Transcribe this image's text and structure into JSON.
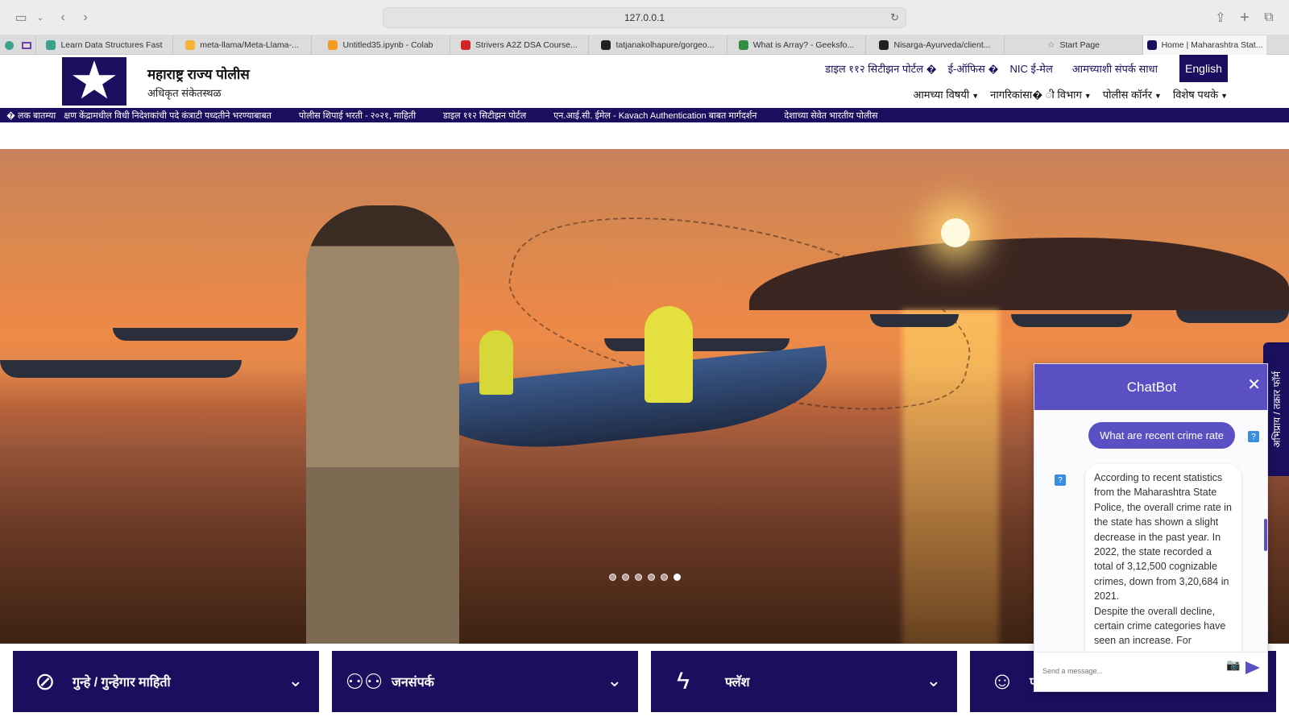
{
  "browser": {
    "url": "127.0.0.1",
    "tabs": [
      {
        "label": "Learn Data Structures Fast",
        "color": "#3ba38a"
      },
      {
        "label": "meta-llama/Meta-Llama-...",
        "color": "#f2b233"
      },
      {
        "label": "Untitled35.ipynb - Colab",
        "color": "#f49b21"
      },
      {
        "label": "Strivers A2Z DSA Course...",
        "color": "#d22525"
      },
      {
        "label": "tatjanakolhapure/gorgeo...",
        "color": "#222222"
      },
      {
        "label": "What is Array? - Geeksfo...",
        "color": "#2f8d46"
      },
      {
        "label": "Nisarga-Ayurveda/client...",
        "color": "#222222"
      },
      {
        "label": "Start Page",
        "color": "#999999"
      },
      {
        "label": "Home | Maharashtra Stat...",
        "color": "#1a0f5e"
      }
    ]
  },
  "header": {
    "title": "महाराष्ट्र राज्य पोलीस",
    "subtitle": "अधिकृत संकेतस्थळ",
    "top_links": [
      "डाइल ११२ सिटीझन पोर्टल �",
      "ई-ऑफिस �",
      "NIC ई-मेल",
      "आमच्याशी संपर्क साधा"
    ],
    "language_button": "English",
    "nav": [
      "आमच्या विषयी",
      "नागरिकांसा� ी विभाग",
      "पोलीस कॉर्नर",
      "विशेष पथके"
    ]
  },
  "ticker": {
    "lead": "� लक बातम्या",
    "items": [
      "क्षण केंद्रामधील विधी निदेशकांची पदे कंत्राटी पध्दतीने भरण्याबाबत",
      "पोलीस शिपाई भरती - २०२१, माहिती",
      "डाइल ११२ सिटीझन पोर्टल",
      "एन.आई.सी. ईमेल - Kavach Authentication बाबत मार्गदर्शन",
      "देशाच्या सेवेत भारतीय पोलीस"
    ]
  },
  "carousel": {
    "slides": 6,
    "active": 6
  },
  "cards": [
    {
      "label": "गुन्हे / गुन्हेगार माहिती",
      "icon": "handcuffs-icon"
    },
    {
      "label": "जनसंपर्क",
      "icon": "people-icon"
    },
    {
      "label": "फ्लॅश",
      "icon": "lightning-icon"
    },
    {
      "label": "पो",
      "icon": "police-officer-icon"
    }
  ],
  "side_tab": {
    "label": "अभिप्राय / तक्रार फॉर्म"
  },
  "chatbot": {
    "title": "ChatBot",
    "user_message": "What are recent crime rate",
    "bot_message": "According to recent statistics from the Maharashtra State Police, the overall crime rate in the state has shown a slight decrease in the past year. In 2022, the state recorded a total of 3,12,500 cognizable crimes, down from 3,20,684 in 2021.\nDespite the overall decline, certain crime categories have seen an increase. For",
    "input_placeholder": "Send a message..."
  }
}
